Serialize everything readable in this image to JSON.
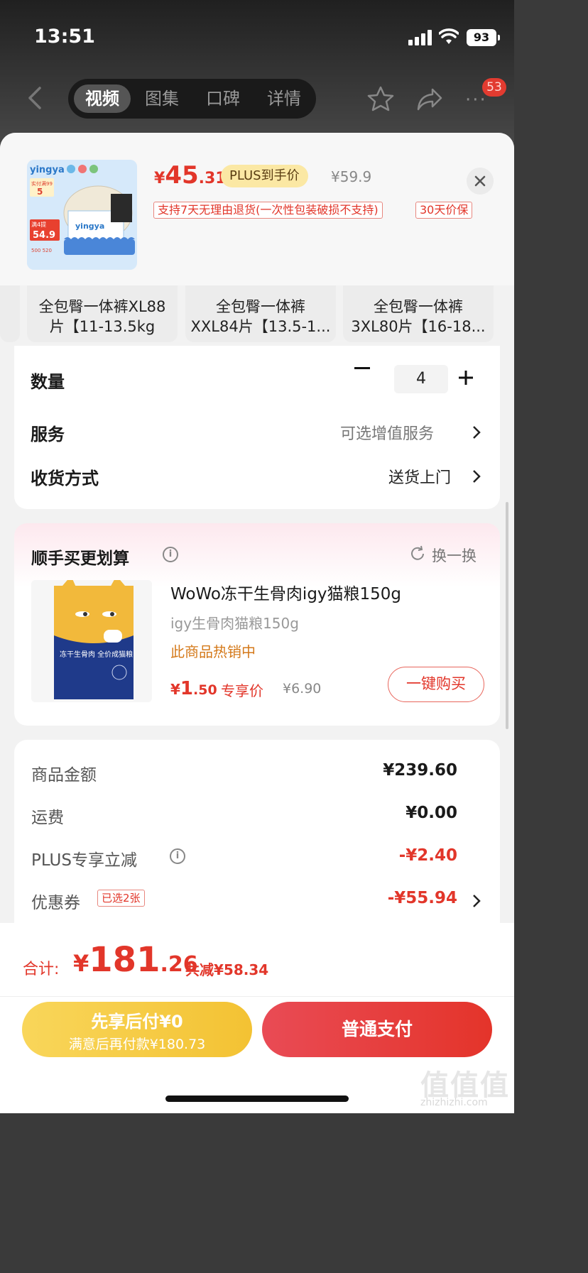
{
  "status_bar": {
    "time": "13:51",
    "battery": "93"
  },
  "nav": {
    "tabs": [
      "视频",
      "图集",
      "口碑",
      "详情"
    ],
    "active_tab": 0,
    "cart_count": "53"
  },
  "product": {
    "price_currency": "¥",
    "price_int": "45",
    "price_dec": ".31",
    "plus_label": "PLUS到手价",
    "original_price": "¥59.9",
    "tags": [
      "支持7天无理由退货(一次性包装破损不支持)",
      "30天价保"
    ],
    "thumb_text": {
      "brand": "yingya",
      "promo1": "实付满99",
      "promo2": "5",
      "promo3": "满4提",
      "promo4": "54.9",
      "promo5": "500 520"
    }
  },
  "variants": [
    {
      "line1": "全包臀一体裤XL88",
      "line2": "片【11-13.5kg"
    },
    {
      "line1": "全包臀一体裤",
      "line2": "XXL84片【13.5-1..."
    },
    {
      "line1": "全包臀一体裤",
      "line2": "3XL80片【16-18..."
    }
  ],
  "options": {
    "quantity_label": "数量",
    "quantity_value": "4",
    "service_label": "服务",
    "service_value": "可选增值服务",
    "delivery_label": "收货方式",
    "delivery_value": "送货上门"
  },
  "upsell": {
    "title": "顺手买更划算",
    "swap_label": "换一换",
    "name": "WoWo冻干生骨肉igy猫粮150g",
    "subtitle": "igy生骨肉猫粮150g",
    "hot": "此商品热销中",
    "price_cur": "¥",
    "price_int": "1",
    "price_dec": ".50",
    "exclusive": "专享价",
    "original": "¥6.90",
    "buy_label": "一键购买",
    "bag_text": "冻干生骨肉 全价成猫粮"
  },
  "summary": {
    "goods_label": "商品金额",
    "goods_value": "¥239.60",
    "shipping_label": "运费",
    "shipping_value": "¥0.00",
    "plus_label": "PLUS专享立减",
    "plus_value": "-¥2.40",
    "coupon_label": "优惠券",
    "coupon_tag": "已选2张",
    "coupon_value": "-¥55.94"
  },
  "footer": {
    "total_label": "合计:",
    "total_cur": "¥",
    "total_int": "181",
    "total_dec": ".26",
    "total_save": "共减¥58.34",
    "later_line1": "先享后付¥0",
    "later_line2": "满意后再付款¥180.73",
    "pay_label": "普通支付",
    "watermark": "值值值",
    "watermark_url": "zhizhizhi.com"
  },
  "colors": {
    "accent": "#e2362a",
    "gold": "#f3c233",
    "plus_tag": "#fbe8a4"
  }
}
